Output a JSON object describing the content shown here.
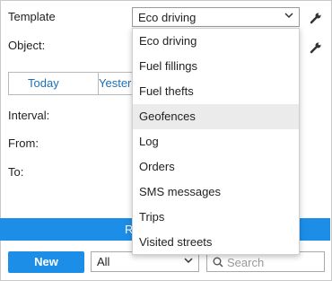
{
  "form": {
    "template_label": "Template",
    "template_value": "Eco driving",
    "object_label": "Object:",
    "interval_label": "Interval:",
    "from_label": "From:",
    "to_label": "To:"
  },
  "tabs": [
    {
      "label": "Today"
    },
    {
      "label": "Yesterday"
    }
  ],
  "execute_button_label": "R",
  "template_options": [
    {
      "label": "Eco driving"
    },
    {
      "label": "Fuel fillings"
    },
    {
      "label": "Fuel thefts"
    },
    {
      "label": "Geofences"
    },
    {
      "label": "Log"
    },
    {
      "label": "Orders"
    },
    {
      "label": "SMS messages"
    },
    {
      "label": "Trips"
    },
    {
      "label": "Visited streets"
    }
  ],
  "highlighted_option": "Geofences",
  "bottom": {
    "new_label": "New",
    "filter_value": "All",
    "search_placeholder": "Search"
  }
}
